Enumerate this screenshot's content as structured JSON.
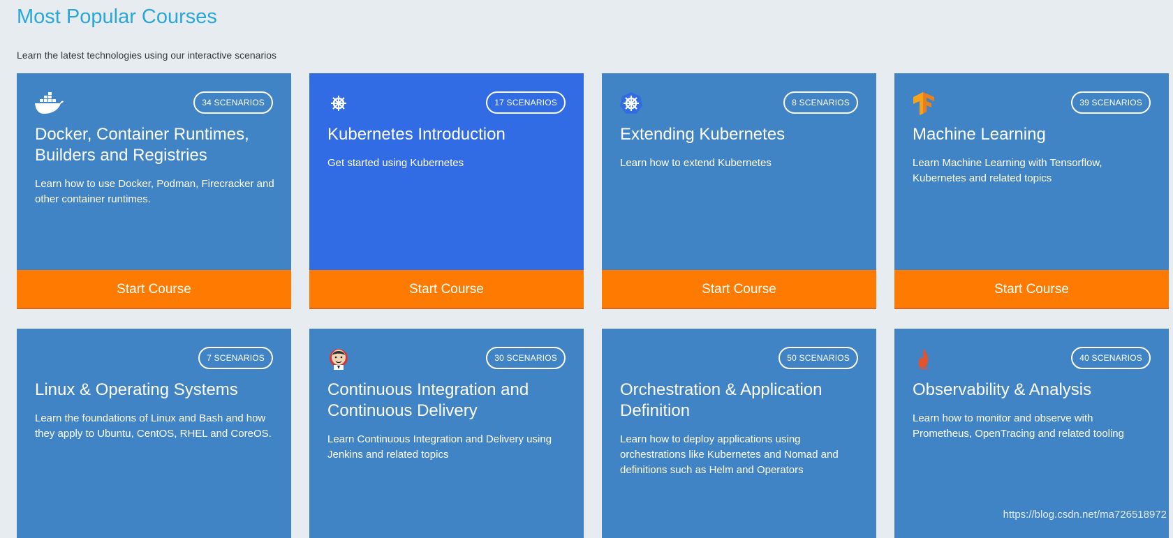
{
  "header": {
    "title": "Most Popular Courses",
    "subtitle": "Learn the latest technologies using our interactive scenarios"
  },
  "courses": [
    {
      "badge": "34 SCENARIOS",
      "title": "Docker, Container Runtimes, Builders and Registries",
      "description": "Learn how to use Docker, Podman, Firecracker and other container runtimes.",
      "button": "Start Course",
      "icon": "docker-whale-icon"
    },
    {
      "badge": "17 SCENARIOS",
      "title": "Kubernetes Introduction",
      "description": "Get started using Kubernetes",
      "button": "Start Course",
      "icon": "kubernetes-helm-icon"
    },
    {
      "badge": "8 SCENARIOS",
      "title": "Extending Kubernetes",
      "description": "Learn how to extend Kubernetes",
      "button": "Start Course",
      "icon": "kubernetes-helm-icon"
    },
    {
      "badge": "39 SCENARIOS",
      "title": "Machine Learning",
      "description": "Learn Machine Learning with Tensorflow, Kubernetes and related topics",
      "button": "Start Course",
      "icon": "tensorflow-icon"
    },
    {
      "badge": "7 SCENARIOS",
      "title": "Linux & Operating Systems",
      "description": "Learn the foundations of Linux and Bash and how they apply to Ubuntu, CentOS, RHEL and CoreOS.",
      "icon": ""
    },
    {
      "badge": "30 SCENARIOS",
      "title": "Continuous Integration and Continuous Delivery",
      "description": "Learn Continuous Integration and Delivery using Jenkins and related topics",
      "icon": "jenkins-icon"
    },
    {
      "badge": "50 SCENARIOS",
      "title": "Orchestration & Application Definition",
      "description": "Learn how to deploy applications using orchestrations like Kubernetes and Nomad and definitions such as Helm and Operators",
      "icon": ""
    },
    {
      "badge": "40 SCENARIOS",
      "title": "Observability & Analysis",
      "description": "Learn how to monitor and observe with Prometheus, OpenTracing and related tooling",
      "icon": "prometheus-icon"
    }
  ],
  "watermark": "https://blog.csdn.net/ma726518972",
  "colors": {
    "card": "#4184c5",
    "card_highlight": "#326ce5",
    "button": "#ff7a00",
    "title": "#2aa7d8",
    "background": "#e6ecef"
  }
}
